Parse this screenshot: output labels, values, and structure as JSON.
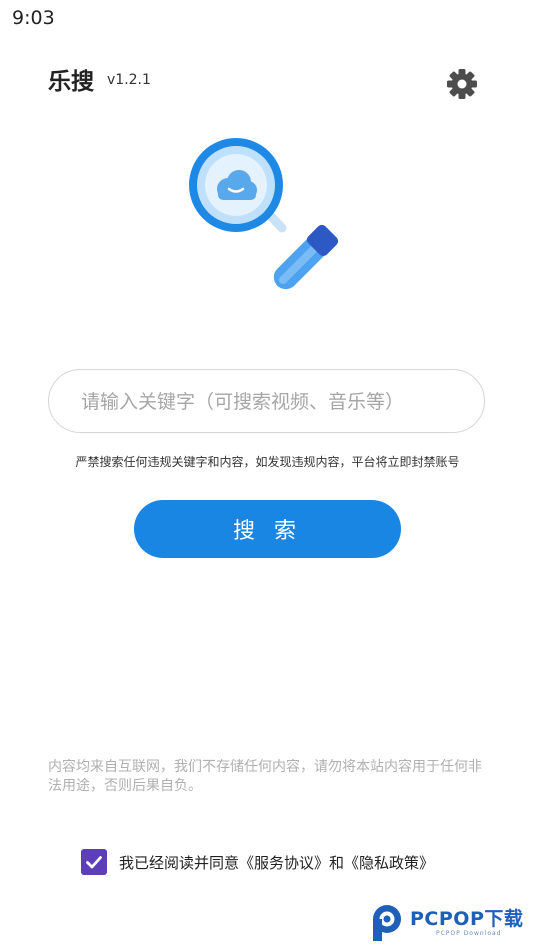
{
  "status": {
    "time": "9:03"
  },
  "header": {
    "title": "乐搜",
    "version": "v1.2.1",
    "settings_icon": "gear-icon"
  },
  "hero": {
    "icon": "magnifier-cloud-icon"
  },
  "search": {
    "placeholder": "请输入关键字（可搜索视频、音乐等）",
    "value": ""
  },
  "warning": "严禁搜索任何违规关键字和内容，如发现违规内容，平台将立即封禁账号",
  "search_button": "搜 索",
  "disclaimer": "内容均来自互联网，我们不存储任何内容，请勿将本站内容用于任何非法用途，否则后果自负。",
  "agreement": {
    "checked": true,
    "text": "我已经阅读并同意《服务协议》和《隐私政策》"
  },
  "watermark": {
    "brand": "PCPOP下载",
    "sub": "PCPOP Download"
  },
  "colors": {
    "accent": "#1a86e3",
    "checkbox": "#5c3eb8",
    "muted": "#b0b0b0"
  }
}
